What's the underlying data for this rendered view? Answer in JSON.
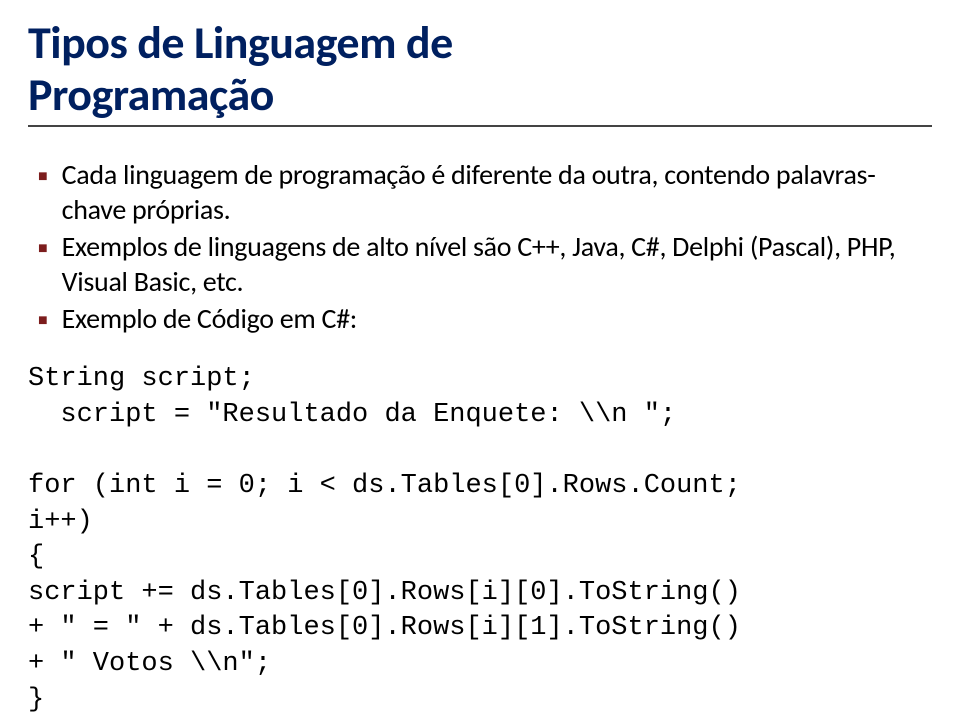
{
  "title_line1": "Tipos de Linguagem de",
  "title_line2": "Programação",
  "bullets": [
    "Cada linguagem de programação é diferente da outra, contendo palavras-chave próprias.",
    "Exemplos de linguagens de alto nível são C++, Java, C#, Delphi (Pascal), PHP, Visual Basic, etc.",
    "Exemplo de Código em C#:"
  ],
  "code": "String script;\n  script = \"Resultado da Enquete: \\\\n \";\n\nfor (int i = 0; i < ds.Tables[0].Rows.Count;\ni++)\n{\nscript += ds.Tables[0].Rows[i][0].ToString()\n+ \" = \" + ds.Tables[0].Rows[i][1].ToString()\n+ \" Votos \\\\n\";\n}"
}
